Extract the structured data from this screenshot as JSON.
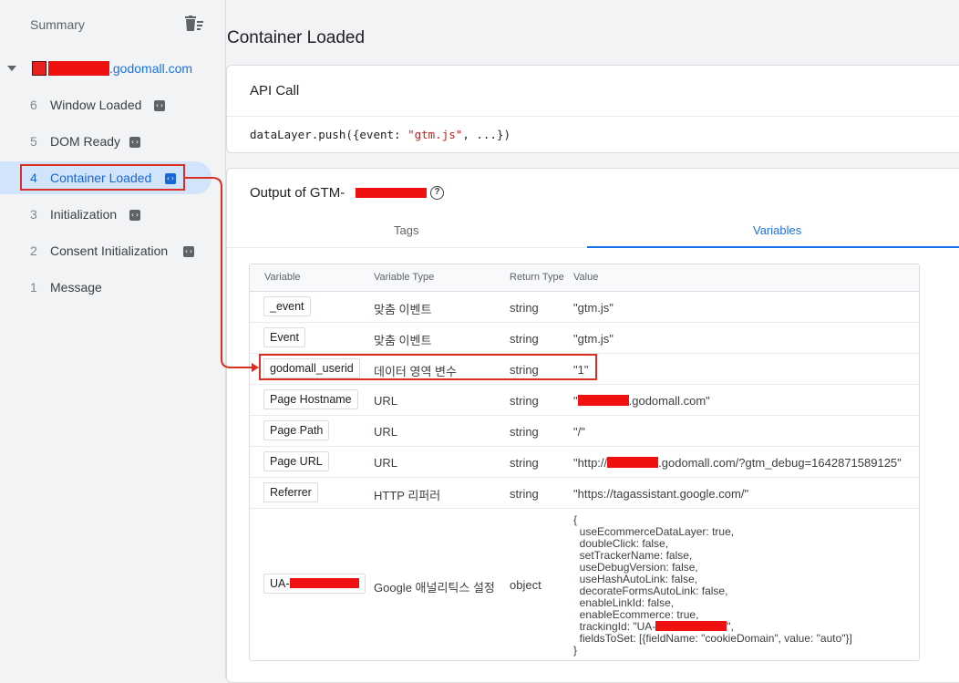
{
  "sidebar": {
    "summary_label": "Summary",
    "container_domain": ".godomall.com",
    "items": [
      {
        "num": "6",
        "label": "Window Loaded",
        "badge": "‹›"
      },
      {
        "num": "5",
        "label": "DOM Ready",
        "badge": "‹›"
      },
      {
        "num": "4",
        "label": "Container Loaded",
        "badge": "‹›"
      },
      {
        "num": "3",
        "label": "Initialization",
        "badge": "‹›"
      },
      {
        "num": "2",
        "label": "Consent Initialization",
        "badge": "‹›"
      },
      {
        "num": "1",
        "label": "Message"
      }
    ]
  },
  "main": {
    "title": "Container Loaded",
    "api_call": {
      "title": "API Call",
      "code_prefix": "dataLayer.push({event: ",
      "code_string": "\"gtm.js\"",
      "code_suffix": ", ...})"
    },
    "output": {
      "title": "Output of GTM-",
      "help_icon": "?",
      "tabs": {
        "tags": "Tags",
        "variables": "Variables"
      },
      "table": {
        "headers": {
          "variable": "Variable",
          "type": "Variable Type",
          "return": "Return Type",
          "value": "Value"
        },
        "rows": [
          {
            "name": "_event",
            "type": "맞춤 이벤트",
            "ret": "string",
            "value": "\"gtm.js\""
          },
          {
            "name": "Event",
            "type": "맞춤 이벤트",
            "ret": "string",
            "value": "\"gtm.js\""
          },
          {
            "name": "godomall_userid",
            "type": "데이터 영역 변수",
            "ret": "string",
            "value": "\"1\""
          },
          {
            "name": "Page Hostname",
            "type": "URL",
            "ret": "string",
            "value_pre": "\"",
            "value_post": ".godomall.com\""
          },
          {
            "name": "Page Path",
            "type": "URL",
            "ret": "string",
            "value": "\"/\""
          },
          {
            "name": "Page URL",
            "type": "URL",
            "ret": "string",
            "value_pre": "\"http://",
            "value_post": ".godomall.com/?gtm_debug=1642871589125\""
          },
          {
            "name": "Referrer",
            "type": "HTTP 리퍼러",
            "ret": "string",
            "value": "\"https://tagassistant.google.com/\""
          },
          {
            "name": "UA-",
            "type": "Google 애널리틱스 설정",
            "ret": "object",
            "value_lines_1": "{\n  useEcommerceDataLayer: true,\n  doubleClick: false,\n  setTrackerName: false,\n  useDebugVersion: false,\n  useHashAutoLink: false,\n  decorateFormsAutoLink: false,\n  enableLinkId: false,\n  enableEcommerce: true,\n  trackingId: \"UA-",
            "value_lines_2": "\",\n  fieldsToSet: [{fieldName: \"cookieDomain\", value: \"auto\"}]\n}"
          }
        ]
      }
    }
  },
  "colors": {
    "accent": "#1a73e8",
    "highlight": "#d93025",
    "redaction": "#ef1010"
  }
}
